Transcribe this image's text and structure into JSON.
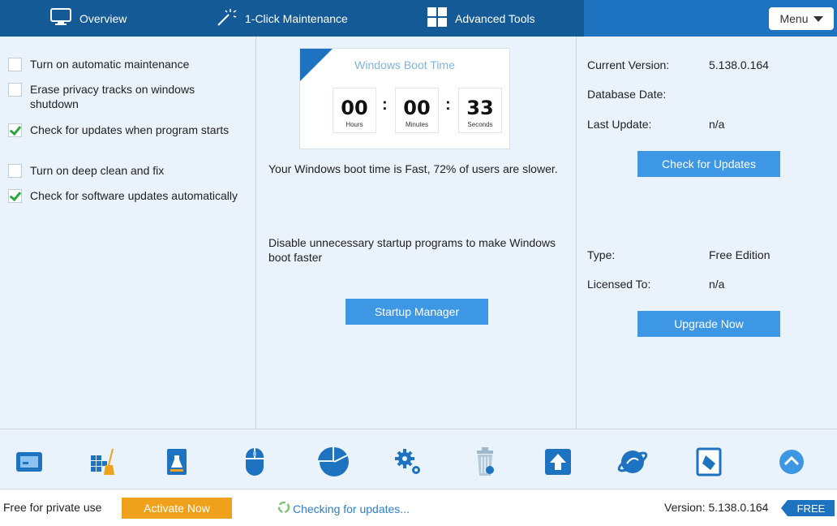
{
  "tabs": {
    "overview": "Overview",
    "maintenance": "1-Click Maintenance",
    "tools": "Advanced Tools",
    "menu": "Menu"
  },
  "options": [
    {
      "label": "Turn on automatic maintenance",
      "checked": false
    },
    {
      "label": "Erase privacy tracks on windows shutdown",
      "checked": false
    },
    {
      "label": "Check for updates when program starts",
      "checked": true
    },
    {
      "label": "Turn on deep clean and fix",
      "checked": false
    },
    {
      "label": "Check for software updates automatically",
      "checked": true
    }
  ],
  "boot": {
    "title": "Windows Boot Time",
    "hours": "00",
    "hours_label": "Hours",
    "minutes": "00",
    "minutes_label": "Minutes",
    "seconds": "33",
    "seconds_label": "Seconds",
    "summary": "Your Windows boot time is Fast, 72% of users are slower.",
    "tip": "Disable unnecessary startup programs to make Windows boot faster",
    "startup_button": "Startup Manager"
  },
  "info": {
    "current_version_label": "Current Version:",
    "current_version": "5.138.0.164",
    "database_date_label": "Database Date:",
    "database_date": "",
    "last_update_label": "Last Update:",
    "last_update": "n/a",
    "check_button": "Check for Updates",
    "type_label": "Type:",
    "type": "Free Edition",
    "licensed_label": "Licensed To:",
    "licensed": "n/a",
    "upgrade_button": "Upgrade Now"
  },
  "toolbar_icons": [
    "screen-icon",
    "grid-broom-icon",
    "cleaner-bottle-icon",
    "mouse-icon",
    "pie-chart-icon",
    "gears-icon",
    "recycle-bin-icon",
    "upload-arrow-icon",
    "globe-icon",
    "document-edit-icon",
    "chevron-up-icon"
  ],
  "status": {
    "free_text": "Free for private use",
    "activate": "Activate Now",
    "checking": "Checking for updates...",
    "version": "Version: 5.138.0.164",
    "badge": "FREE"
  },
  "colors": {
    "accent": "#1e73c0",
    "button": "#3d97e4",
    "activate": "#f0a11b",
    "check": "#2aa63c"
  }
}
